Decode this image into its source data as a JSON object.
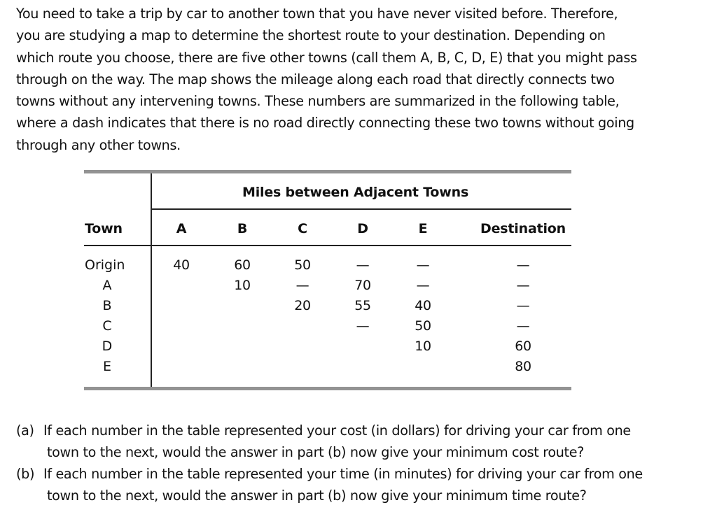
{
  "intro_lines": [
    "You need to take a trip by car to another town that you have never visited before. Therefore,",
    "you are studying a map to determine the shortest route to your destination. Depending on",
    "which route you choose, there are five other towns (call them A, B, C, D, E) that you might pass",
    "through on the way. The map shows the mileage along each road that directly connects two",
    "towns without any intervening towns. These numbers are summarized in the following table,",
    "where a dash indicates that there is no road directly connecting these two towns without going",
    "through any other towns."
  ],
  "table": {
    "row_header": "Town",
    "group_header": "Miles between Adjacent Towns",
    "columns": [
      "A",
      "B",
      "C",
      "D",
      "E",
      "Destination"
    ],
    "rows": [
      {
        "town": "Origin",
        "cells": [
          "40",
          "60",
          "50",
          "—",
          "—",
          "—"
        ]
      },
      {
        "town": "A",
        "cells": [
          "",
          "10",
          "—",
          "70",
          "—",
          "—"
        ]
      },
      {
        "town": "B",
        "cells": [
          "",
          "",
          "20",
          "55",
          "40",
          "—"
        ]
      },
      {
        "town": "C",
        "cells": [
          "",
          "",
          "",
          "—",
          "50",
          "—"
        ]
      },
      {
        "town": "D",
        "cells": [
          "",
          "",
          "",
          "",
          "10",
          "60"
        ]
      },
      {
        "town": "E",
        "cells": [
          "",
          "",
          "",
          "",
          "",
          "80"
        ]
      }
    ]
  },
  "questions": [
    {
      "tag": "(a)",
      "line1": "If each number in the table represented your cost (in dollars) for driving your car from one",
      "line2": "town to the next, would the answer in part (b) now give your minimum cost route?"
    },
    {
      "tag": "(b)",
      "line1": "If each number in the table represented your time (in minutes) for driving your car from one",
      "line2": "town to the next, would the answer in part (b) now give your minimum time route?"
    }
  ]
}
